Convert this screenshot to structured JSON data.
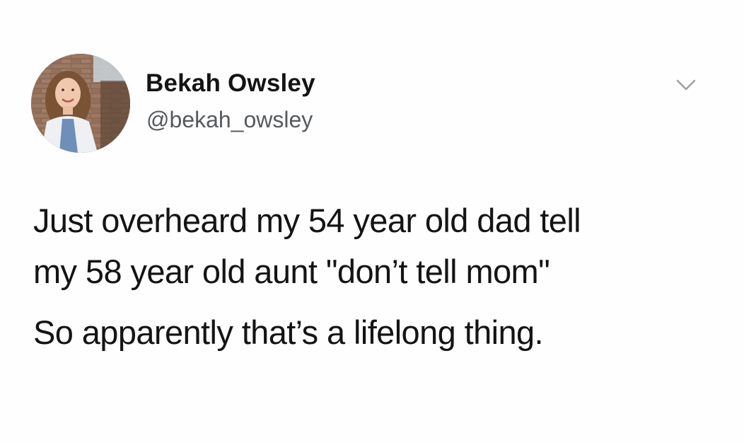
{
  "tweet": {
    "author": {
      "display_name": "Bekah Owsley",
      "handle": "@bekah_owsley",
      "avatar_icon": "profile-photo"
    },
    "menu_icon": "chevron-down-icon",
    "text_lines": [
      "Just overheard my 54 year old dad tell",
      "my 58 year old aunt \"don’t tell mom\"",
      "So apparently that’s a lifelong thing."
    ]
  },
  "colors": {
    "background": "#fefefe",
    "text": "#141414",
    "handle": "#555a5e",
    "caret": "#9aa0a4"
  }
}
